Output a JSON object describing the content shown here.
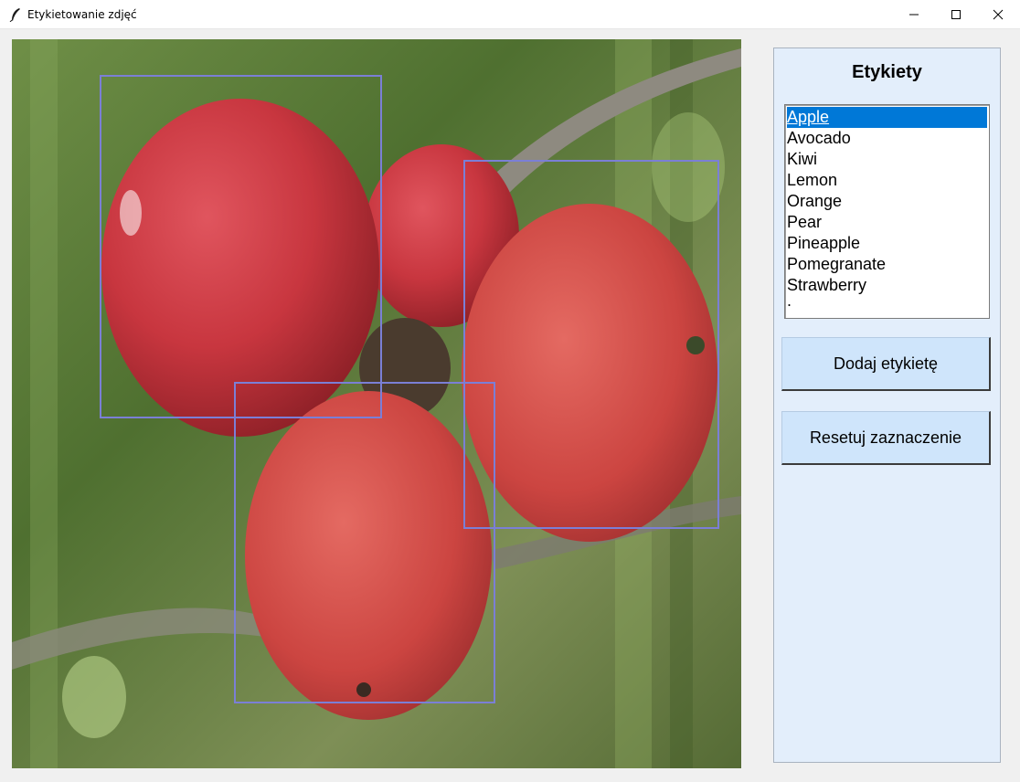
{
  "window": {
    "title": "Etykietowanie zdjęć",
    "icon": "feather-icon",
    "controls": [
      "minimize-icon",
      "maximize-icon",
      "close-icon"
    ]
  },
  "canvas": {
    "image": "red apples on a branch",
    "box_color": "#7b7fd6",
    "selection_count": 3
  },
  "sidebar": {
    "title": "Etykiety",
    "labels": [
      "Apple",
      "Avocado",
      "Kiwi",
      "Lemon",
      "Orange",
      "Pear",
      "Pineapple",
      "Pomegranate",
      "Strawberry",
      "."
    ],
    "selected_label": "Apple",
    "add_button": "Dodaj etykietę",
    "reset_button": "Resetuj zaznaczenie"
  },
  "colors": {
    "selected_bg": "#0078d7",
    "panel_bg": "#e3eefb",
    "button_bg": "#cfe5fb"
  }
}
